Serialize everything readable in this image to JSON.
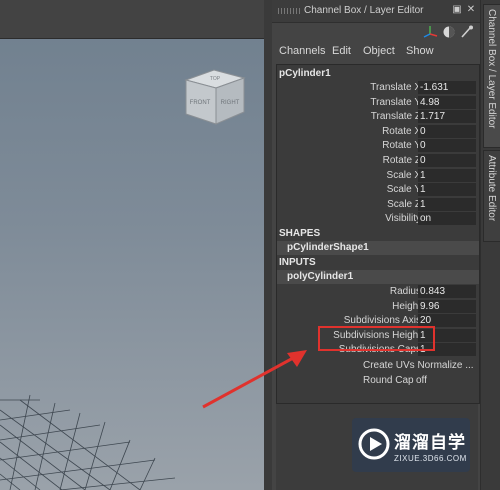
{
  "panel": {
    "title": "Channel Box / Layer Editor",
    "menu": [
      "Channels",
      "Edit",
      "Object",
      "Show"
    ]
  },
  "viewcube": {
    "front": "FRONT",
    "right": "RIGHT",
    "top": "TOP"
  },
  "object": {
    "name": "pCylinder1",
    "channels": [
      {
        "label": "Translate X",
        "value": "-1.631"
      },
      {
        "label": "Translate Y",
        "value": "4.98"
      },
      {
        "label": "Translate Z",
        "value": "1.717"
      },
      {
        "label": "Rotate X",
        "value": "0"
      },
      {
        "label": "Rotate Y",
        "value": "0"
      },
      {
        "label": "Rotate Z",
        "value": "0"
      },
      {
        "label": "Scale X",
        "value": "1"
      },
      {
        "label": "Scale Y",
        "value": "1"
      },
      {
        "label": "Scale Z",
        "value": "1"
      },
      {
        "label": "Visibility",
        "value": "on"
      }
    ]
  },
  "shapes": {
    "header": "SHAPES",
    "name": "pCylinderShape1"
  },
  "inputs": {
    "header": "INPUTS",
    "name": "polyCylinder1",
    "channels": [
      {
        "label": "Radius",
        "value": "0.843"
      },
      {
        "label": "Height",
        "value": "9.96"
      },
      {
        "label": "Subdivisions Axis",
        "value": "20"
      },
      {
        "label": "Subdivisions Height",
        "value": "1"
      },
      {
        "label": "Subdivisions Caps",
        "value": "1"
      }
    ],
    "create_uvs": "Create UVs Normalize ...",
    "round_cap": {
      "label": "Round Cap",
      "value": "off"
    }
  },
  "side_tabs": [
    "Channel Box / Layer Editor",
    "Attribute Editor"
  ],
  "watermark": {
    "brand": "溜溜自学",
    "url": "ZIXUE.3D66.COM"
  },
  "colors": {
    "highlight": "#e0322d",
    "panel_bg": "#444444"
  }
}
